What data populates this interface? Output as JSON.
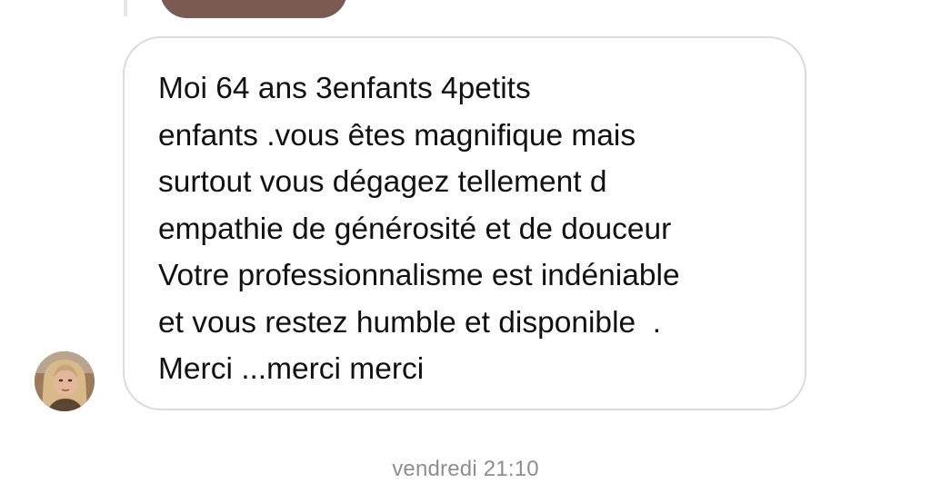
{
  "conversation": {
    "message": {
      "lines": [
        "Moi 64 ans 3enfants 4petits",
        "enfants .vous êtes magnifique mais",
        "surtout vous dégagez tellement d",
        "empathie de générosité et de douceur",
        "Votre professionnalisme est indéniable",
        "et vous restez humble et disponible  .",
        "Merci ...merci merci"
      ]
    },
    "timestamp": "vendredi 21:10"
  },
  "colors": {
    "bubble_border": "#dbdbdb",
    "text": "#111111",
    "timestamp": "#8e8e8e",
    "previous_message_bubble": "#7b5a53"
  }
}
